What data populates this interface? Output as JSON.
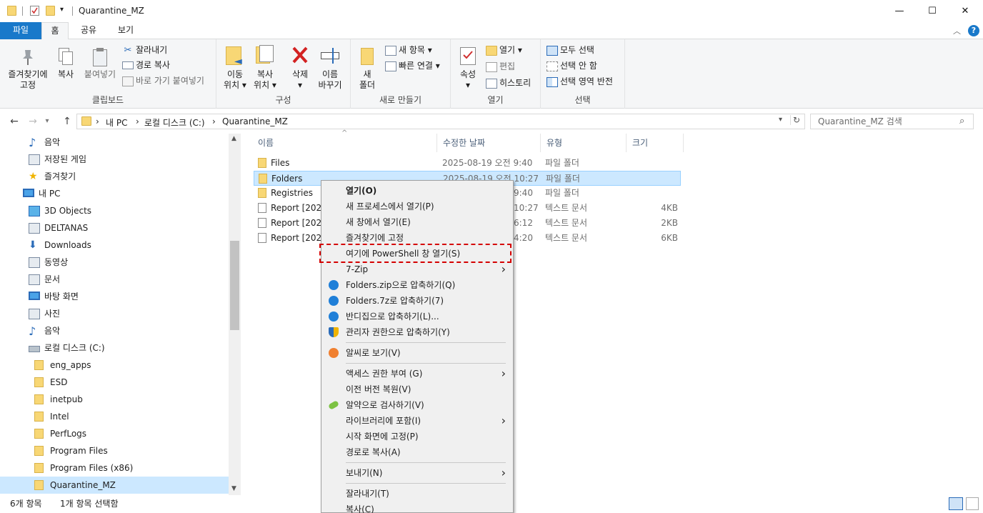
{
  "window": {
    "title": "Quarantine_MZ",
    "minimize": "—",
    "maximize": "☐",
    "close": "✕"
  },
  "ribbon_tabs": [
    "파일",
    "홈",
    "공유",
    "보기"
  ],
  "ribbon": {
    "clipboard": {
      "label": "클립보드",
      "pin": [
        "즐겨찾기에",
        "고정"
      ],
      "copy": "복사",
      "paste": "붙여넣기",
      "cut": "잘라내기",
      "copy_path": "경로 복사",
      "paste_shortcut": "바로 가기 붙여넣기"
    },
    "organize": {
      "label": "구성",
      "move_to": [
        "이동",
        "위치 ▾"
      ],
      "copy_to": [
        "복사",
        "위치 ▾"
      ],
      "delete": [
        "삭제",
        "▾"
      ],
      "rename": [
        "이름",
        "바꾸기"
      ]
    },
    "new": {
      "label": "새로 만들기",
      "new_folder": [
        "새",
        "폴더"
      ],
      "new_item": "새 항목 ▾",
      "easy_access": "빠른 연결 ▾"
    },
    "open": {
      "label": "열기",
      "properties": [
        "속성",
        "▾"
      ],
      "open": "열기 ▾",
      "edit": "편집",
      "history": "히스토리"
    },
    "select": {
      "label": "선택",
      "select_all": "모두 선택",
      "select_none": "선택 안 함",
      "invert": "선택 영역 반전"
    }
  },
  "address": {
    "crumbs": [
      "내 PC",
      "로컬 디스크 (C:)",
      "Quarantine_MZ"
    ],
    "search_placeholder": "Quarantine_MZ 검색"
  },
  "nav": [
    {
      "label": "음악",
      "icon": "music-icon",
      "indent": 1
    },
    {
      "label": "저장된 게임",
      "icon": "saved-games-icon",
      "indent": 1
    },
    {
      "label": "즐겨찾기",
      "icon": "star-icon",
      "indent": 1
    },
    {
      "label": "내 PC",
      "icon": "pc-icon",
      "indent": 0
    },
    {
      "label": "3D Objects",
      "icon": "3d-objects-icon",
      "indent": 1
    },
    {
      "label": "DELTANAS",
      "icon": "network-drive-icon",
      "indent": 1
    },
    {
      "label": "Downloads",
      "icon": "download-icon",
      "indent": 1
    },
    {
      "label": "동영상",
      "icon": "video-icon",
      "indent": 1
    },
    {
      "label": "문서",
      "icon": "document-icon",
      "indent": 1
    },
    {
      "label": "바탕 화면",
      "icon": "desktop-icon",
      "indent": 1
    },
    {
      "label": "사진",
      "icon": "picture-icon",
      "indent": 1
    },
    {
      "label": "음악",
      "icon": "music-icon",
      "indent": 1
    },
    {
      "label": "로컬 디스크 (C:)",
      "icon": "drive-icon",
      "indent": 1
    },
    {
      "label": "eng_apps",
      "icon": "folder-icon",
      "indent": 2
    },
    {
      "label": "ESD",
      "icon": "folder-icon",
      "indent": 2
    },
    {
      "label": "inetpub",
      "icon": "folder-icon",
      "indent": 2
    },
    {
      "label": "Intel",
      "icon": "folder-icon",
      "indent": 2
    },
    {
      "label": "PerfLogs",
      "icon": "folder-icon",
      "indent": 2
    },
    {
      "label": "Program Files",
      "icon": "folder-icon",
      "indent": 2
    },
    {
      "label": "Program Files (x86)",
      "icon": "folder-icon",
      "indent": 2
    },
    {
      "label": "Quarantine_MZ",
      "icon": "folder-icon",
      "indent": 2,
      "selected": true
    }
  ],
  "columns": [
    "이름",
    "수정한 날짜",
    "유형",
    "크기"
  ],
  "files": [
    {
      "name": "Files",
      "date": "2025-08-19 오전 9:40",
      "type": "파일 폴더",
      "size": "",
      "kind": "folder"
    },
    {
      "name": "Folders",
      "date": "2025-08-19 오전 10:27",
      "type": "파일 폴더",
      "size": "",
      "kind": "folder",
      "selected": true
    },
    {
      "name": "Registries",
      "date": "9:40",
      "type": "파일 폴더",
      "size": "",
      "kind": "folder"
    },
    {
      "name": "Report [2025",
      "date": "10:27",
      "type": "텍스트 문서",
      "size": "4KB",
      "kind": "text"
    },
    {
      "name": "Report [2023",
      "date": "6:12",
      "type": "텍스트 문서",
      "size": "2KB",
      "kind": "text"
    },
    {
      "name": "Report [2023",
      "date": "4:20",
      "type": "텍스트 문서",
      "size": "6KB",
      "kind": "text"
    }
  ],
  "status": {
    "count": "6개 항목",
    "selected": "1개 항목 선택함"
  },
  "context_menu": [
    {
      "label": "열기(O)",
      "bold": true
    },
    {
      "label": "새 프로세스에서 열기(P)"
    },
    {
      "label": "새 창에서 열기(E)"
    },
    {
      "label": "즐겨찾기에 고정"
    },
    {
      "label": "여기에 PowerShell 창 열기(S)",
      "highlighted": true
    },
    {
      "label": "7-Zip",
      "submenu": true
    },
    {
      "label": "Folders.zip으로 압축하기(Q)",
      "icon": "bandizip-icon"
    },
    {
      "label": "Folders.7z로 압축하기(7)",
      "icon": "bandizip-icon"
    },
    {
      "label": "반디집으로 압축하기(L)...",
      "icon": "bandizip-icon"
    },
    {
      "label": "관리자 권한으로 압축하기(Y)",
      "icon": "shield-icon"
    },
    {
      "separator": true
    },
    {
      "label": "알씨로 보기(V)",
      "icon": "alsee-icon"
    },
    {
      "separator": true
    },
    {
      "label": "액세스 권한 부여 (G)",
      "submenu": true
    },
    {
      "label": "이전 버전 복원(V)"
    },
    {
      "label": "알약으로 검사하기(V)",
      "icon": "alyac-icon"
    },
    {
      "label": "라이브러리에 포함(I)",
      "submenu": true
    },
    {
      "label": "시작 화면에 고정(P)"
    },
    {
      "label": "경로로 복사(A)"
    },
    {
      "separator": true
    },
    {
      "label": "보내기(N)",
      "submenu": true
    },
    {
      "separator": true
    },
    {
      "label": "잘라내기(T)"
    },
    {
      "label": "복사(C)"
    }
  ]
}
